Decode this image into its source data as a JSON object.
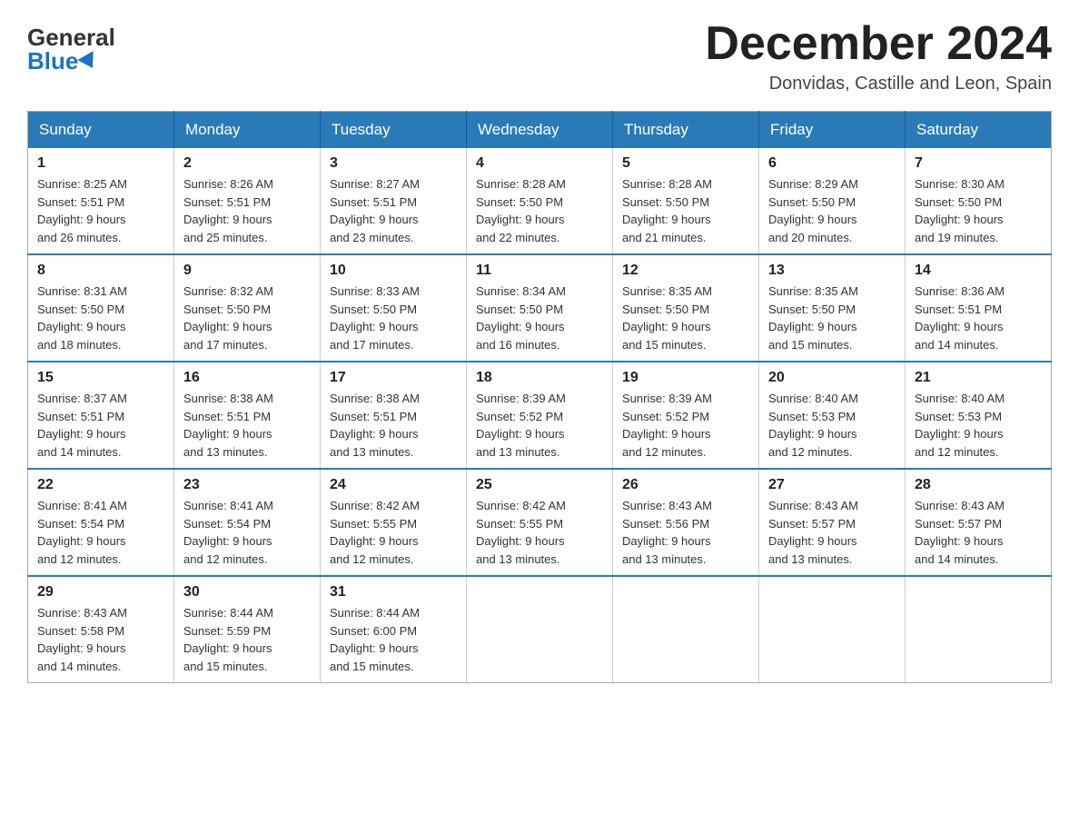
{
  "header": {
    "logo_general": "General",
    "logo_blue": "Blue",
    "title": "December 2024",
    "subtitle": "Donvidas, Castille and Leon, Spain"
  },
  "calendar": {
    "days_of_week": [
      "Sunday",
      "Monday",
      "Tuesday",
      "Wednesday",
      "Thursday",
      "Friday",
      "Saturday"
    ],
    "weeks": [
      [
        {
          "day": "1",
          "info": "Sunrise: 8:25 AM\nSunset: 5:51 PM\nDaylight: 9 hours\nand 26 minutes."
        },
        {
          "day": "2",
          "info": "Sunrise: 8:26 AM\nSunset: 5:51 PM\nDaylight: 9 hours\nand 25 minutes."
        },
        {
          "day": "3",
          "info": "Sunrise: 8:27 AM\nSunset: 5:51 PM\nDaylight: 9 hours\nand 23 minutes."
        },
        {
          "day": "4",
          "info": "Sunrise: 8:28 AM\nSunset: 5:50 PM\nDaylight: 9 hours\nand 22 minutes."
        },
        {
          "day": "5",
          "info": "Sunrise: 8:28 AM\nSunset: 5:50 PM\nDaylight: 9 hours\nand 21 minutes."
        },
        {
          "day": "6",
          "info": "Sunrise: 8:29 AM\nSunset: 5:50 PM\nDaylight: 9 hours\nand 20 minutes."
        },
        {
          "day": "7",
          "info": "Sunrise: 8:30 AM\nSunset: 5:50 PM\nDaylight: 9 hours\nand 19 minutes."
        }
      ],
      [
        {
          "day": "8",
          "info": "Sunrise: 8:31 AM\nSunset: 5:50 PM\nDaylight: 9 hours\nand 18 minutes."
        },
        {
          "day": "9",
          "info": "Sunrise: 8:32 AM\nSunset: 5:50 PM\nDaylight: 9 hours\nand 17 minutes."
        },
        {
          "day": "10",
          "info": "Sunrise: 8:33 AM\nSunset: 5:50 PM\nDaylight: 9 hours\nand 17 minutes."
        },
        {
          "day": "11",
          "info": "Sunrise: 8:34 AM\nSunset: 5:50 PM\nDaylight: 9 hours\nand 16 minutes."
        },
        {
          "day": "12",
          "info": "Sunrise: 8:35 AM\nSunset: 5:50 PM\nDaylight: 9 hours\nand 15 minutes."
        },
        {
          "day": "13",
          "info": "Sunrise: 8:35 AM\nSunset: 5:50 PM\nDaylight: 9 hours\nand 15 minutes."
        },
        {
          "day": "14",
          "info": "Sunrise: 8:36 AM\nSunset: 5:51 PM\nDaylight: 9 hours\nand 14 minutes."
        }
      ],
      [
        {
          "day": "15",
          "info": "Sunrise: 8:37 AM\nSunset: 5:51 PM\nDaylight: 9 hours\nand 14 minutes."
        },
        {
          "day": "16",
          "info": "Sunrise: 8:38 AM\nSunset: 5:51 PM\nDaylight: 9 hours\nand 13 minutes."
        },
        {
          "day": "17",
          "info": "Sunrise: 8:38 AM\nSunset: 5:51 PM\nDaylight: 9 hours\nand 13 minutes."
        },
        {
          "day": "18",
          "info": "Sunrise: 8:39 AM\nSunset: 5:52 PM\nDaylight: 9 hours\nand 13 minutes."
        },
        {
          "day": "19",
          "info": "Sunrise: 8:39 AM\nSunset: 5:52 PM\nDaylight: 9 hours\nand 12 minutes."
        },
        {
          "day": "20",
          "info": "Sunrise: 8:40 AM\nSunset: 5:53 PM\nDaylight: 9 hours\nand 12 minutes."
        },
        {
          "day": "21",
          "info": "Sunrise: 8:40 AM\nSunset: 5:53 PM\nDaylight: 9 hours\nand 12 minutes."
        }
      ],
      [
        {
          "day": "22",
          "info": "Sunrise: 8:41 AM\nSunset: 5:54 PM\nDaylight: 9 hours\nand 12 minutes."
        },
        {
          "day": "23",
          "info": "Sunrise: 8:41 AM\nSunset: 5:54 PM\nDaylight: 9 hours\nand 12 minutes."
        },
        {
          "day": "24",
          "info": "Sunrise: 8:42 AM\nSunset: 5:55 PM\nDaylight: 9 hours\nand 12 minutes."
        },
        {
          "day": "25",
          "info": "Sunrise: 8:42 AM\nSunset: 5:55 PM\nDaylight: 9 hours\nand 13 minutes."
        },
        {
          "day": "26",
          "info": "Sunrise: 8:43 AM\nSunset: 5:56 PM\nDaylight: 9 hours\nand 13 minutes."
        },
        {
          "day": "27",
          "info": "Sunrise: 8:43 AM\nSunset: 5:57 PM\nDaylight: 9 hours\nand 13 minutes."
        },
        {
          "day": "28",
          "info": "Sunrise: 8:43 AM\nSunset: 5:57 PM\nDaylight: 9 hours\nand 14 minutes."
        }
      ],
      [
        {
          "day": "29",
          "info": "Sunrise: 8:43 AM\nSunset: 5:58 PM\nDaylight: 9 hours\nand 14 minutes."
        },
        {
          "day": "30",
          "info": "Sunrise: 8:44 AM\nSunset: 5:59 PM\nDaylight: 9 hours\nand 15 minutes."
        },
        {
          "day": "31",
          "info": "Sunrise: 8:44 AM\nSunset: 6:00 PM\nDaylight: 9 hours\nand 15 minutes."
        },
        {
          "day": "",
          "info": ""
        },
        {
          "day": "",
          "info": ""
        },
        {
          "day": "",
          "info": ""
        },
        {
          "day": "",
          "info": ""
        }
      ]
    ]
  }
}
